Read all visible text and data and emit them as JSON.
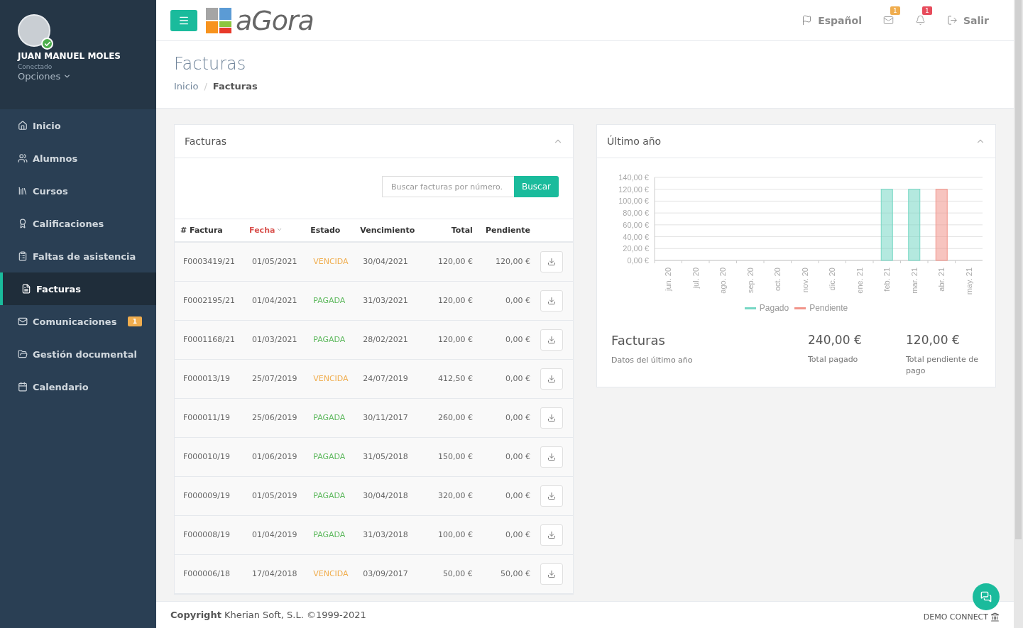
{
  "user": {
    "name": "JUAN MANUEL MOLES",
    "status": "Conectado",
    "options": "Opciones",
    "online": true
  },
  "sidebar": {
    "items": [
      {
        "label": "Inicio",
        "selected": false
      },
      {
        "label": "Alumnos",
        "selected": false
      },
      {
        "label": "Cursos",
        "selected": false
      },
      {
        "label": "Calificaciones",
        "selected": false
      },
      {
        "label": "Faltas de asistencia",
        "selected": false
      },
      {
        "label": "Facturas",
        "selected": true
      },
      {
        "label": "Comunicaciones",
        "selected": false,
        "badge": "1"
      },
      {
        "label": "Gestión documental",
        "selected": false
      },
      {
        "label": "Calendario",
        "selected": false
      }
    ]
  },
  "topbar": {
    "logo": "aGora",
    "language": "Español",
    "mail_badge": "1",
    "bell_badge": "1",
    "logout": "Salir"
  },
  "page": {
    "title": "Facturas",
    "breadcrumb_separator": "/",
    "breadcrumb": [
      {
        "label": "Inicio",
        "selected": false
      },
      {
        "label": "Facturas",
        "selected": true
      }
    ]
  },
  "invoices_panel": {
    "title": "Facturas",
    "search": {
      "placeholder": "Buscar facturas por número.",
      "button": "Buscar"
    },
    "columns": [
      {
        "label": "# Factura",
        "sorted": false
      },
      {
        "label": "Fecha",
        "sorted": true
      },
      {
        "label": "Estado",
        "sorted": false
      },
      {
        "label": "Vencimiento",
        "sorted": false
      },
      {
        "label": "Total",
        "sorted": false
      },
      {
        "label": "Pendiente",
        "sorted": false
      }
    ],
    "rows": [
      {
        "number": "F0003419/21",
        "date": "01/05/2021",
        "status": "VENCIDA",
        "kind": "overdue",
        "due": "30/04/2021",
        "total": "120,00 €",
        "pending": "120,00 €"
      },
      {
        "number": "F0002195/21",
        "date": "01/04/2021",
        "status": "PAGADA",
        "kind": "paid",
        "due": "31/03/2021",
        "total": "120,00 €",
        "pending": "0,00 €"
      },
      {
        "number": "F0001168/21",
        "date": "01/03/2021",
        "status": "PAGADA",
        "kind": "paid",
        "due": "28/02/2021",
        "total": "120,00 €",
        "pending": "0,00 €"
      },
      {
        "number": "F000013/19",
        "date": "25/07/2019",
        "status": "VENCIDA",
        "kind": "overdue",
        "due": "24/07/2019",
        "total": "412,50 €",
        "pending": "0,00 €"
      },
      {
        "number": "F000011/19",
        "date": "25/06/2019",
        "status": "PAGADA",
        "kind": "paid",
        "due": "30/11/2017",
        "total": "260,00 €",
        "pending": "0,00 €"
      },
      {
        "number": "F000010/19",
        "date": "01/06/2019",
        "status": "PAGADA",
        "kind": "paid",
        "due": "31/05/2018",
        "total": "150,00 €",
        "pending": "0,00 €"
      },
      {
        "number": "F000009/19",
        "date": "01/05/2019",
        "status": "PAGADA",
        "kind": "paid",
        "due": "30/04/2018",
        "total": "320,00 €",
        "pending": "0,00 €"
      },
      {
        "number": "F000008/19",
        "date": "01/04/2019",
        "status": "PAGADA",
        "kind": "paid",
        "due": "31/03/2018",
        "total": "100,00 €",
        "pending": "0,00 €"
      },
      {
        "number": "F000006/18",
        "date": "17/04/2018",
        "status": "VENCIDA",
        "kind": "overdue",
        "due": "03/09/2017",
        "total": "50,00 €",
        "pending": "50,00 €"
      }
    ]
  },
  "year_panel": {
    "title": "Último año",
    "chart_data": {
      "type": "bar",
      "stacked": true,
      "grid": true,
      "categories": [
        "jun. 20",
        "jul. 20",
        "ago. 20",
        "sep. 20",
        "oct. 20",
        "nov. 20",
        "dic. 20",
        "ene. 21",
        "feb. 21",
        "mar. 21",
        "abr. 21",
        "may. 21"
      ],
      "series": [
        {
          "name": "Pagado",
          "color": "#76d7c4",
          "values": [
            0,
            0,
            0,
            0,
            0,
            0,
            0,
            0,
            120,
            120,
            0,
            0
          ]
        },
        {
          "name": "Pendiente",
          "color": "#f1948a",
          "values": [
            0,
            0,
            0,
            0,
            0,
            0,
            0,
            0,
            0,
            0,
            120,
            0
          ]
        }
      ],
      "ylim": [
        0,
        140
      ],
      "yticks": [
        {
          "value": 0,
          "label": "0,00 €"
        },
        {
          "value": 20,
          "label": "20,00 €"
        },
        {
          "value": 40,
          "label": "40,00 €"
        },
        {
          "value": 60,
          "label": "60,00 €"
        },
        {
          "value": 80,
          "label": "80,00 €"
        },
        {
          "value": 100,
          "label": "100,00 €"
        },
        {
          "value": 120,
          "label": "120,00 €"
        },
        {
          "value": 140,
          "label": "140,00 €"
        }
      ]
    },
    "summary": {
      "title": "Facturas",
      "subtitle": "Datos del último año",
      "stats": [
        {
          "value": "240,00 €",
          "label": "Total pagado"
        },
        {
          "value": "120,00 €",
          "label": "Total pendiente de pago"
        }
      ]
    }
  },
  "footer": {
    "copyright_bold": "Copyright",
    "copyright": "Kherian Soft, S.L. ©1999-2021",
    "brand": "DEMO CONNECT"
  }
}
